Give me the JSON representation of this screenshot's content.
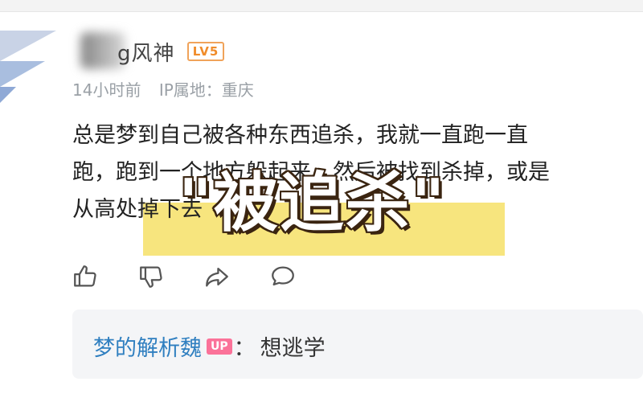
{
  "comment": {
    "username": "g风神",
    "level_badge": "LV5",
    "time": "14小时前",
    "ip_location": "IP属地：重庆",
    "lines": [
      "总是梦到自己被各种东西追杀，我就一直跑一直",
      "跑，跑到一个地方躲起来，然后被找到杀掉，或是",
      "从高处掉下去"
    ]
  },
  "overlay": {
    "caption": "\"被追杀\""
  },
  "actions": {
    "icons": [
      "thumbs-up-icon",
      "thumbs-down-icon",
      "share-icon",
      "reply-icon"
    ]
  },
  "reply": {
    "author": "梦的解析魏",
    "badge": "UP",
    "colon": "：",
    "text": "想逃学"
  },
  "colors": {
    "level_badge": "#f08c2a",
    "reply_author": "#2f7fc0",
    "up_badge": "#fb7299",
    "caption_highlight": "#f5de5a"
  }
}
